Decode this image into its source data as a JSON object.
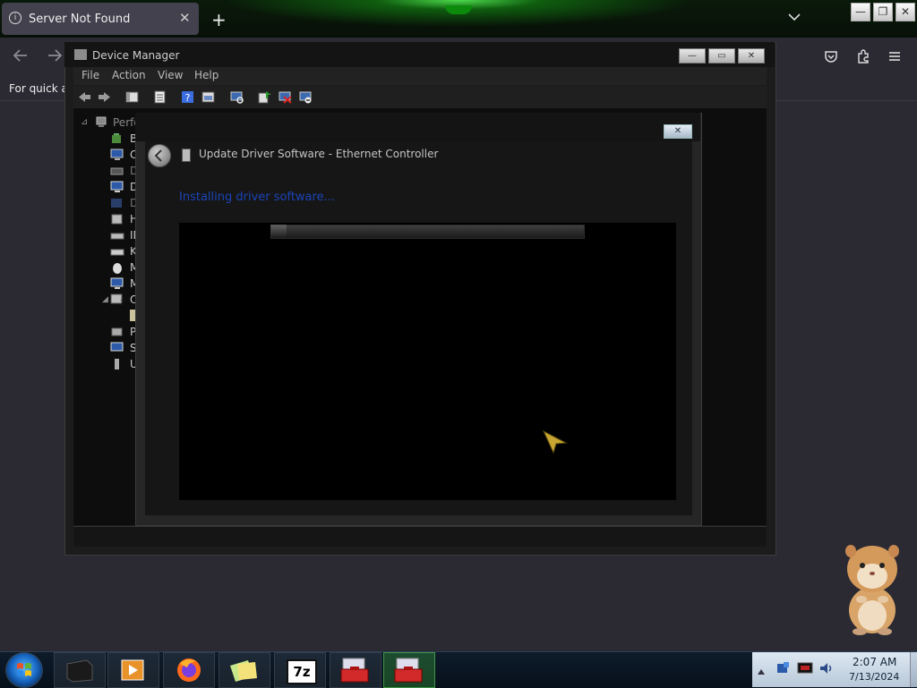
{
  "browser": {
    "tab_title": "Server Not Found",
    "new_tab_symbol": "+",
    "tab_close_symbol": "✕",
    "bookmarks_text": "For quick ac",
    "window_controls": [
      "—",
      "❐",
      "✕"
    ]
  },
  "device_manager": {
    "title": "Device Manager",
    "menu": [
      "File",
      "Action",
      "View",
      "Help"
    ],
    "tree_root": "Perfo",
    "tree_items": [
      "B",
      "C",
      "D",
      "D",
      "D",
      "H",
      "ID",
      "K",
      "M",
      "M",
      "O",
      "P",
      "S",
      "U"
    ],
    "window_controls": [
      "—",
      "▭",
      "✕"
    ]
  },
  "wizard": {
    "title": "Update Driver Software - Ethernet Controller",
    "status_text": "Installing driver software...",
    "close_symbol": "✕",
    "progress": 0.05
  },
  "taskbar": {
    "apps": [
      "terminal",
      "media-player",
      "firefox",
      "sticky-notes",
      "7-zip",
      "toolbox",
      "toolbox"
    ],
    "app_label_7z": "7z",
    "active_index": 6
  },
  "clock": {
    "time": "2:07 AM",
    "date": "7/13/2024"
  }
}
